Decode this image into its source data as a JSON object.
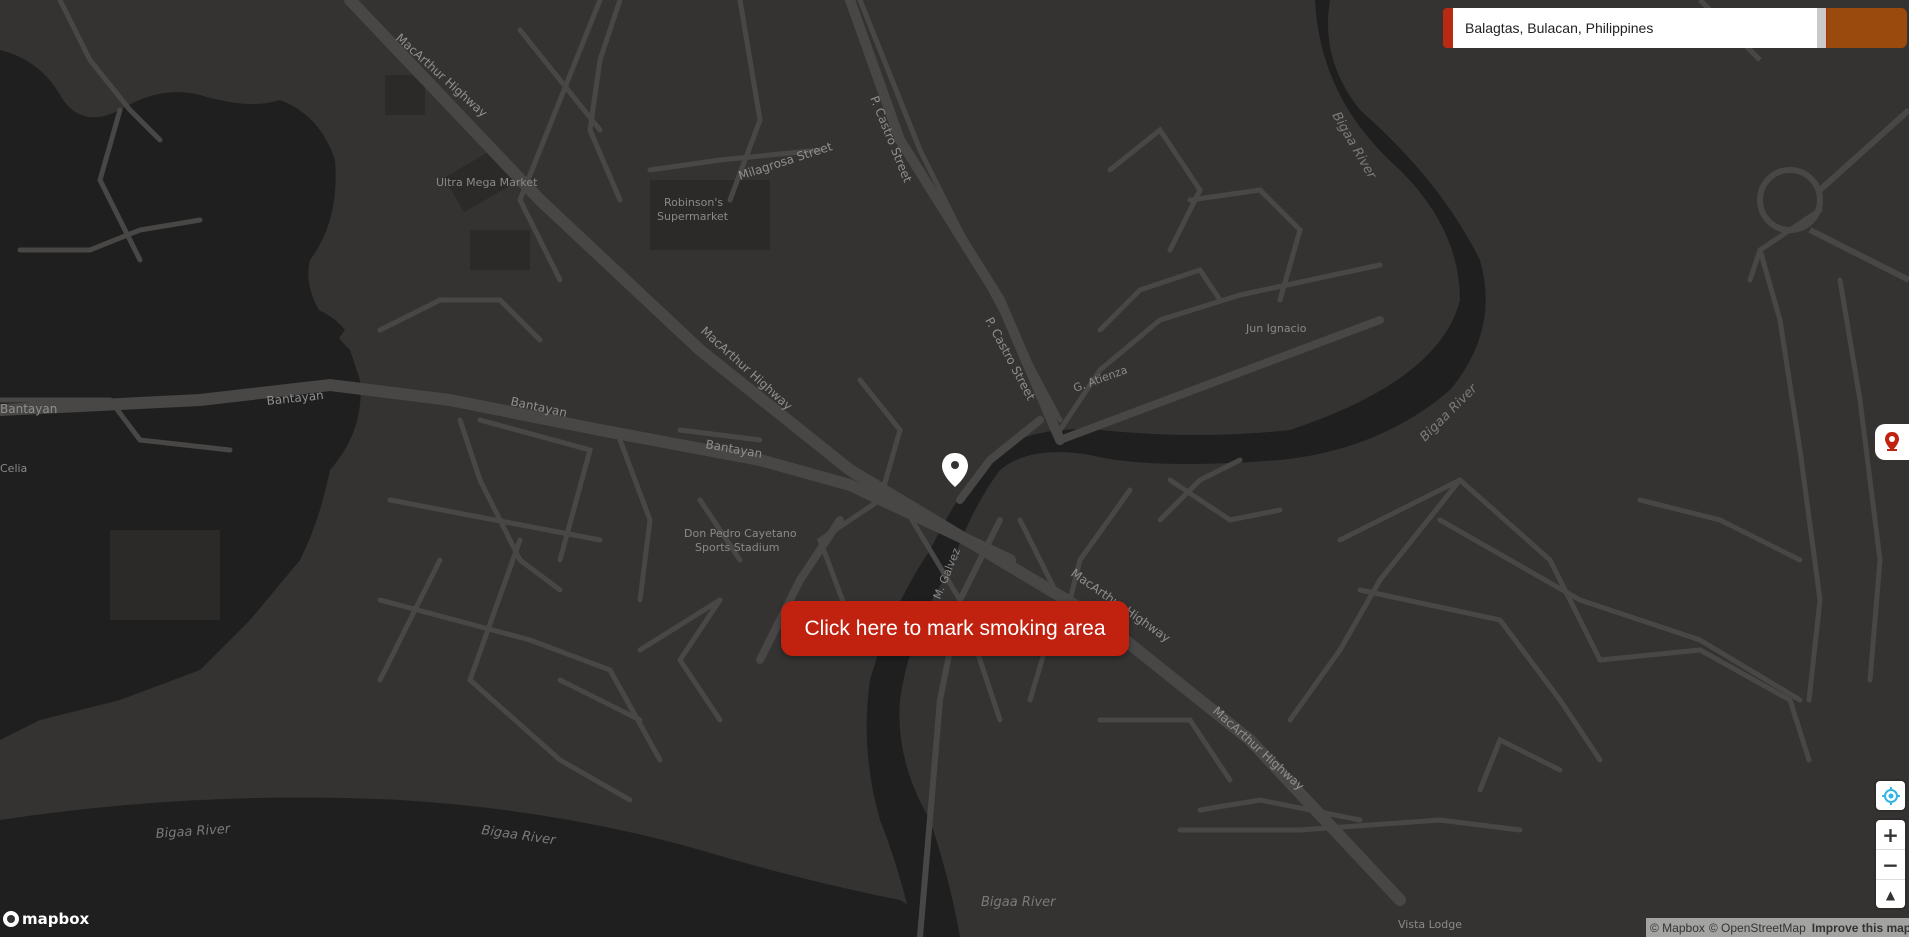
{
  "colors": {
    "map_bg": "#343332",
    "road": "#484746",
    "river": "#1e1f1e",
    "building": "#2b2a29",
    "accent": "#c1210f",
    "search_btn": "#9a4a0c"
  },
  "search": {
    "value": "Balagtas, Bulacan, Philippines"
  },
  "mark_button": {
    "label": "Click here to mark smoking area"
  },
  "zoom": {
    "in_label": "+",
    "out_label": "−",
    "compass_label": "▲"
  },
  "attribution": {
    "mapbox": "© Mapbox",
    "osm": "© OpenStreetMap",
    "improve": "Improve this map"
  },
  "logo": {
    "text": "mapbox"
  },
  "map_labels": {
    "macarthur_1": "MacArthur Highway",
    "macarthur_2": "MacArthur Highway",
    "macarthur_3": "MacArthur Highway",
    "macarthur_4": "MacArthur Highway",
    "castro_1": "P. Castro Street",
    "castro_2": "P. Castro Street",
    "milagrosa": "Milagrosa Street",
    "ultra_mega": "Ultra Mega Market",
    "robinsons_1": "Robinson's",
    "robinsons_2": "Supermarket",
    "bantayan_1": "Bantayan",
    "bantayan_2": "Bantayan",
    "bantayan_3": "Bantayan",
    "bantayan_4": "Bantayan",
    "celia": "Celia",
    "atienza": "G. Atienza",
    "jun_ignacio": "Jun Ignacio",
    "don_pedro_1": "Don Pedro Cayetano",
    "don_pedro_2": "Sports Stadium",
    "galvez": "M. Galvez",
    "bigaa_1": "Bigaa River",
    "bigaa_2": "Bigaa River",
    "bigaa_3": "Bigaa River",
    "bigaa_4": "Bigaa River",
    "bigaa_5": "Bigaa River",
    "vista_lodge": "Vista Lodge"
  },
  "icons": {
    "pin": "map-pin-icon",
    "side": "location-marker-icon",
    "geolocate": "geolocate-icon",
    "compass": "compass-icon"
  }
}
